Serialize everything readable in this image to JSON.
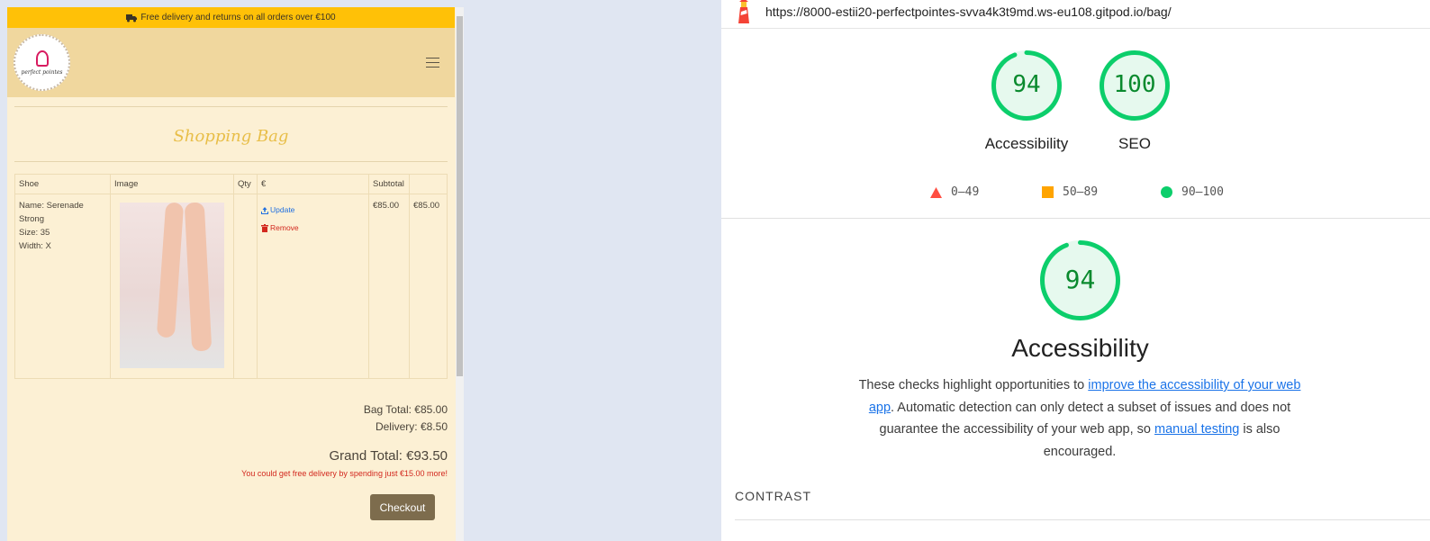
{
  "shop": {
    "promo_text": "Free delivery and returns on all orders over €100",
    "logo_text": "perfect pointes",
    "page_title": "Shopping Bag",
    "table": {
      "headers": [
        "Shoe",
        "Image",
        "Qty",
        "€",
        "Subtotal"
      ],
      "item": {
        "name": "Name: Serenade Strong",
        "size": "Size: 35",
        "width": "Width: X",
        "update_label": "Update",
        "remove_label": "Remove",
        "price": "€85.00",
        "subtotal": "€85.00"
      }
    },
    "bag_total": "Bag Total: €85.00",
    "delivery": "Delivery: €8.50",
    "grand_total": "Grand Total: €93.50",
    "free_delivery_note": "You could get free delivery by spending just €15.00 more!",
    "checkout_label": "Checkout"
  },
  "report": {
    "url": "https://8000-estii20-perfectpointes-svva4k3t9md.ws-eu108.gitpod.io/bag/",
    "scores": [
      {
        "label": "Accessibility",
        "score": 94
      },
      {
        "label": "SEO",
        "score": 100
      }
    ],
    "legend": [
      "0–49",
      "50–89",
      "90–100"
    ],
    "category": {
      "title": "Accessibility",
      "score": 94
    },
    "description": {
      "text1": "These checks highlight opportunities to ",
      "link1": "improve the accessibility of your web app",
      "text2": ". Automatic detection can only detect a subset of issues and does not guarantee the accessibility of your web app, so ",
      "link2": "manual testing",
      "text3": " is also encouraged."
    },
    "section_heading": "CONTRAST"
  },
  "colors": {
    "pass": "#0cce6b",
    "average": "#ffa400",
    "fail": "#ff4e42",
    "promo_bar": "#ffc107",
    "checkout_button": "#7d6c4d"
  }
}
